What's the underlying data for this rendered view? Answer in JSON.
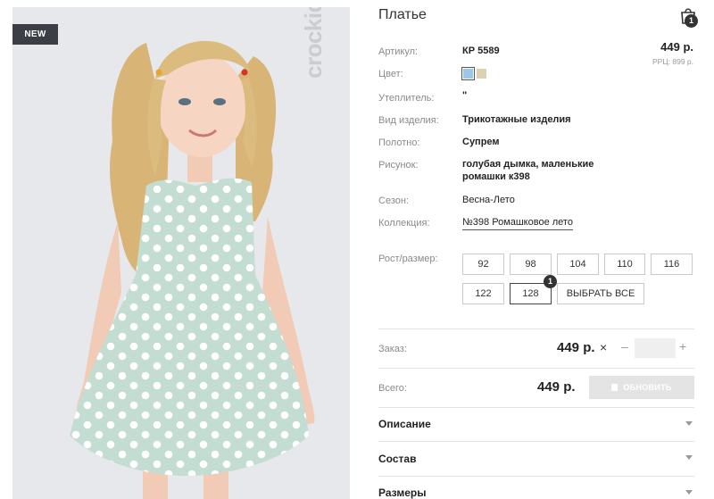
{
  "photo": {
    "badge": "NEW",
    "brand": "crockid"
  },
  "product": {
    "title": "Платье",
    "cart_count": "1",
    "price": "449 р.",
    "rrp": "РРЦ: 899 р."
  },
  "specs": {
    "article_label": "Артикул:",
    "article_value": "КР 5589",
    "color_label": "Цвет:",
    "filler_label": "Утеплитель:",
    "filler_value": "\"",
    "type_label": "Вид изделия:",
    "type_value": "Трикотажные изделия",
    "fabric_label": "Полотно:",
    "fabric_value": "Супрем",
    "pattern_label": "Рисунок:",
    "pattern_line1": "голубая дымка, маленькие",
    "pattern_line2": "ромашки к398",
    "season_label": "Сезон:",
    "season_value": "Весна-Лето",
    "collection_label": "Коллекция:",
    "collection_value": "№398 Ромашковое лето"
  },
  "colors": [
    "#9cc7ea",
    "#dcd2b2"
  ],
  "sizes": {
    "label": "Рост/размер:",
    "items": [
      "92",
      "98",
      "104",
      "110",
      "116",
      "122",
      "128"
    ],
    "selected": "128",
    "selected_count": "1",
    "select_all": "ВЫБРАТЬ ВСЕ"
  },
  "order": {
    "label": "Заказ:",
    "price": "449 р.",
    "remove_icon": "×",
    "minus": "–",
    "plus": "+",
    "quantity": ""
  },
  "total": {
    "label": "Всего:",
    "price": "449 р.",
    "button": "ОБНОВИТЬ"
  },
  "accordion": {
    "description": "Описание",
    "composition": "Состав",
    "sizes": "Размеры"
  }
}
